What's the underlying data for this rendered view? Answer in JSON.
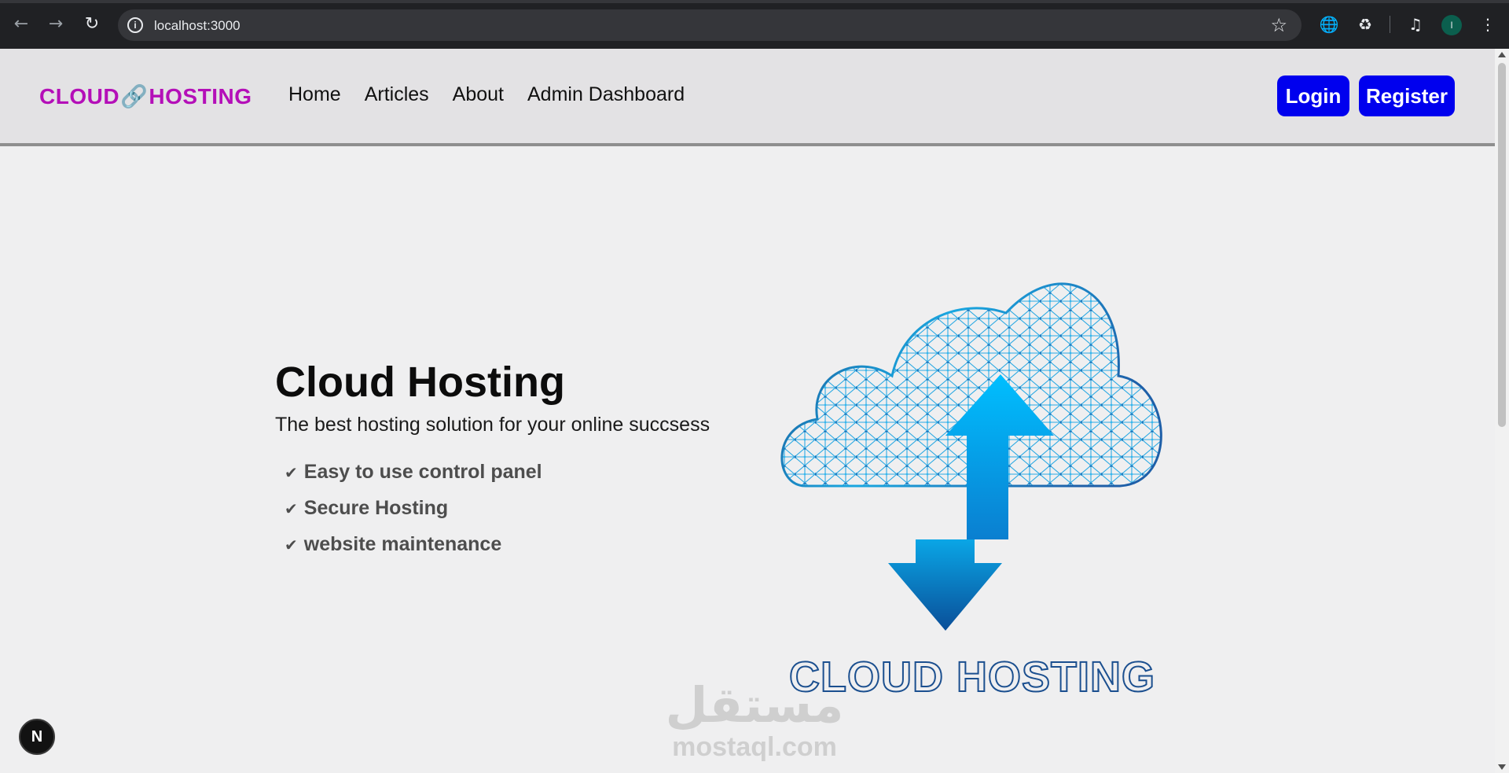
{
  "browser": {
    "url": "localhost:3000",
    "profile_initial": "I",
    "icons": {
      "back": "arrow-left-icon",
      "forward": "arrow-right-icon",
      "reload": "reload-icon",
      "site_info": "info-icon",
      "bookmark": "star-icon",
      "translate": "globe-icon",
      "extensions": "puzzle-icon",
      "media": "media-control-icon",
      "menu": "kebab-menu-icon"
    }
  },
  "header": {
    "logo_left": "CLOUD",
    "logo_right": "HOSTING",
    "logo_color": "#b40fb8",
    "nav": [
      "Home",
      "Articles",
      "About",
      "Admin Dashboard"
    ],
    "login_label": "Login",
    "register_label": "Register",
    "button_color": "#0000ee"
  },
  "hero": {
    "title": "Cloud Hosting",
    "subtitle": "The best hosting solution for your online succsess",
    "features": [
      "Easy to use control panel",
      "Secure Hosting",
      "website maintenance"
    ],
    "image_caption": "CLOUD HOSTING"
  },
  "watermark": {
    "arabic": "مستقل",
    "latin": "mostaql.com"
  },
  "dev_badge": "N"
}
